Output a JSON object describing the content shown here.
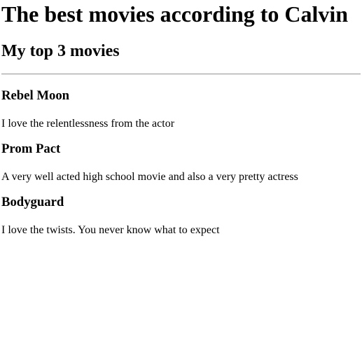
{
  "page": {
    "title": "The best movies according to Calvin",
    "subtitle": "My top 3 movies"
  },
  "movies": [
    {
      "title": "Rebel Moon",
      "comment": "I love the relentlessness from the actor"
    },
    {
      "title": "Prom Pact",
      "comment": "A very well acted high school movie and also a very pretty actress"
    },
    {
      "title": "Bodyguard",
      "comment": "I love the twists. You never know what to expect"
    }
  ]
}
